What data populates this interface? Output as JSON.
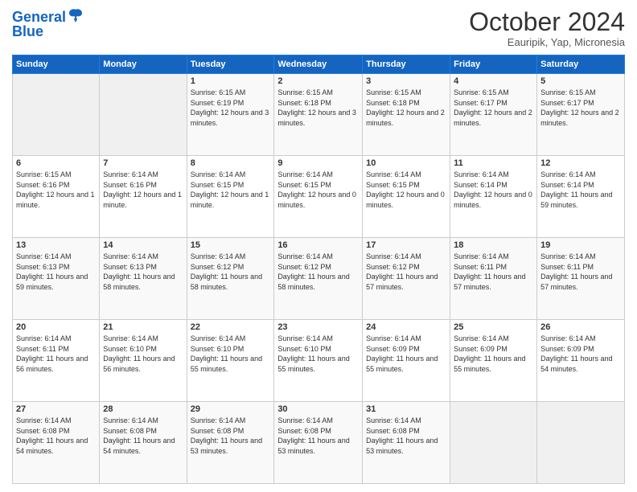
{
  "logo": {
    "line1": "General",
    "line2": "Blue"
  },
  "title": "October 2024",
  "location": "Eauripik, Yap, Micronesia",
  "weekdays": [
    "Sunday",
    "Monday",
    "Tuesday",
    "Wednesday",
    "Thursday",
    "Friday",
    "Saturday"
  ],
  "weeks": [
    [
      {
        "day": "",
        "sunrise": "",
        "sunset": "",
        "daylight": ""
      },
      {
        "day": "",
        "sunrise": "",
        "sunset": "",
        "daylight": ""
      },
      {
        "day": "1",
        "sunrise": "Sunrise: 6:15 AM",
        "sunset": "Sunset: 6:19 PM",
        "daylight": "Daylight: 12 hours and 3 minutes."
      },
      {
        "day": "2",
        "sunrise": "Sunrise: 6:15 AM",
        "sunset": "Sunset: 6:18 PM",
        "daylight": "Daylight: 12 hours and 3 minutes."
      },
      {
        "day": "3",
        "sunrise": "Sunrise: 6:15 AM",
        "sunset": "Sunset: 6:18 PM",
        "daylight": "Daylight: 12 hours and 2 minutes."
      },
      {
        "day": "4",
        "sunrise": "Sunrise: 6:15 AM",
        "sunset": "Sunset: 6:17 PM",
        "daylight": "Daylight: 12 hours and 2 minutes."
      },
      {
        "day": "5",
        "sunrise": "Sunrise: 6:15 AM",
        "sunset": "Sunset: 6:17 PM",
        "daylight": "Daylight: 12 hours and 2 minutes."
      }
    ],
    [
      {
        "day": "6",
        "sunrise": "Sunrise: 6:15 AM",
        "sunset": "Sunset: 6:16 PM",
        "daylight": "Daylight: 12 hours and 1 minute."
      },
      {
        "day": "7",
        "sunrise": "Sunrise: 6:14 AM",
        "sunset": "Sunset: 6:16 PM",
        "daylight": "Daylight: 12 hours and 1 minute."
      },
      {
        "day": "8",
        "sunrise": "Sunrise: 6:14 AM",
        "sunset": "Sunset: 6:15 PM",
        "daylight": "Daylight: 12 hours and 1 minute."
      },
      {
        "day": "9",
        "sunrise": "Sunrise: 6:14 AM",
        "sunset": "Sunset: 6:15 PM",
        "daylight": "Daylight: 12 hours and 0 minutes."
      },
      {
        "day": "10",
        "sunrise": "Sunrise: 6:14 AM",
        "sunset": "Sunset: 6:15 PM",
        "daylight": "Daylight: 12 hours and 0 minutes."
      },
      {
        "day": "11",
        "sunrise": "Sunrise: 6:14 AM",
        "sunset": "Sunset: 6:14 PM",
        "daylight": "Daylight: 12 hours and 0 minutes."
      },
      {
        "day": "12",
        "sunrise": "Sunrise: 6:14 AM",
        "sunset": "Sunset: 6:14 PM",
        "daylight": "Daylight: 11 hours and 59 minutes."
      }
    ],
    [
      {
        "day": "13",
        "sunrise": "Sunrise: 6:14 AM",
        "sunset": "Sunset: 6:13 PM",
        "daylight": "Daylight: 11 hours and 59 minutes."
      },
      {
        "day": "14",
        "sunrise": "Sunrise: 6:14 AM",
        "sunset": "Sunset: 6:13 PM",
        "daylight": "Daylight: 11 hours and 58 minutes."
      },
      {
        "day": "15",
        "sunrise": "Sunrise: 6:14 AM",
        "sunset": "Sunset: 6:12 PM",
        "daylight": "Daylight: 11 hours and 58 minutes."
      },
      {
        "day": "16",
        "sunrise": "Sunrise: 6:14 AM",
        "sunset": "Sunset: 6:12 PM",
        "daylight": "Daylight: 11 hours and 58 minutes."
      },
      {
        "day": "17",
        "sunrise": "Sunrise: 6:14 AM",
        "sunset": "Sunset: 6:12 PM",
        "daylight": "Daylight: 11 hours and 57 minutes."
      },
      {
        "day": "18",
        "sunrise": "Sunrise: 6:14 AM",
        "sunset": "Sunset: 6:11 PM",
        "daylight": "Daylight: 11 hours and 57 minutes."
      },
      {
        "day": "19",
        "sunrise": "Sunrise: 6:14 AM",
        "sunset": "Sunset: 6:11 PM",
        "daylight": "Daylight: 11 hours and 57 minutes."
      }
    ],
    [
      {
        "day": "20",
        "sunrise": "Sunrise: 6:14 AM",
        "sunset": "Sunset: 6:11 PM",
        "daylight": "Daylight: 11 hours and 56 minutes."
      },
      {
        "day": "21",
        "sunrise": "Sunrise: 6:14 AM",
        "sunset": "Sunset: 6:10 PM",
        "daylight": "Daylight: 11 hours and 56 minutes."
      },
      {
        "day": "22",
        "sunrise": "Sunrise: 6:14 AM",
        "sunset": "Sunset: 6:10 PM",
        "daylight": "Daylight: 11 hours and 55 minutes."
      },
      {
        "day": "23",
        "sunrise": "Sunrise: 6:14 AM",
        "sunset": "Sunset: 6:10 PM",
        "daylight": "Daylight: 11 hours and 55 minutes."
      },
      {
        "day": "24",
        "sunrise": "Sunrise: 6:14 AM",
        "sunset": "Sunset: 6:09 PM",
        "daylight": "Daylight: 11 hours and 55 minutes."
      },
      {
        "day": "25",
        "sunrise": "Sunrise: 6:14 AM",
        "sunset": "Sunset: 6:09 PM",
        "daylight": "Daylight: 11 hours and 55 minutes."
      },
      {
        "day": "26",
        "sunrise": "Sunrise: 6:14 AM",
        "sunset": "Sunset: 6:09 PM",
        "daylight": "Daylight: 11 hours and 54 minutes."
      }
    ],
    [
      {
        "day": "27",
        "sunrise": "Sunrise: 6:14 AM",
        "sunset": "Sunset: 6:08 PM",
        "daylight": "Daylight: 11 hours and 54 minutes."
      },
      {
        "day": "28",
        "sunrise": "Sunrise: 6:14 AM",
        "sunset": "Sunset: 6:08 PM",
        "daylight": "Daylight: 11 hours and 54 minutes."
      },
      {
        "day": "29",
        "sunrise": "Sunrise: 6:14 AM",
        "sunset": "Sunset: 6:08 PM",
        "daylight": "Daylight: 11 hours and 53 minutes."
      },
      {
        "day": "30",
        "sunrise": "Sunrise: 6:14 AM",
        "sunset": "Sunset: 6:08 PM",
        "daylight": "Daylight: 11 hours and 53 minutes."
      },
      {
        "day": "31",
        "sunrise": "Sunrise: 6:14 AM",
        "sunset": "Sunset: 6:08 PM",
        "daylight": "Daylight: 11 hours and 53 minutes."
      },
      {
        "day": "",
        "sunrise": "",
        "sunset": "",
        "daylight": ""
      },
      {
        "day": "",
        "sunrise": "",
        "sunset": "",
        "daylight": ""
      }
    ]
  ]
}
